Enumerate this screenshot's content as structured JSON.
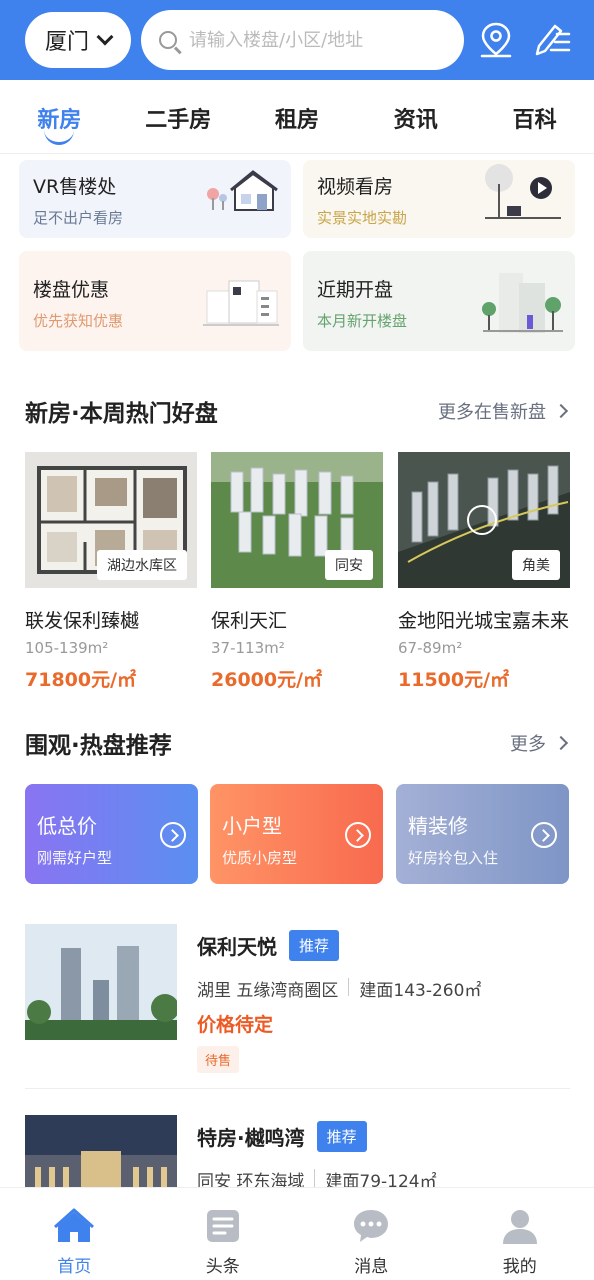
{
  "header": {
    "city": "厦门",
    "search_placeholder": "请输入楼盘/小区/地址"
  },
  "tabs": [
    {
      "label": "新房",
      "active": true
    },
    {
      "label": "二手房"
    },
    {
      "label": "租房"
    },
    {
      "label": "资讯"
    },
    {
      "label": "百科"
    }
  ],
  "features": [
    {
      "title": "VR售楼处",
      "subtitle": "足不出户看房"
    },
    {
      "title": "视频看房",
      "subtitle": "实景实地实勘"
    },
    {
      "title": "楼盘优惠",
      "subtitle": "优先获知优惠"
    },
    {
      "title": "近期开盘",
      "subtitle": "本月新开楼盘"
    }
  ],
  "hot_section": {
    "title": "新房·本周热门好盘",
    "more": "更多在售新盘",
    "items": [
      {
        "name": "联发保利臻樾",
        "area_tag": "湖边水库区",
        "size": "105-139m²",
        "price": "71800元/㎡"
      },
      {
        "name": "保利天汇",
        "area_tag": "同安",
        "size": "37-113m²",
        "price": "26000元/㎡"
      },
      {
        "name": "金地阳光城宝嘉未来",
        "area_tag": "角美",
        "size": "67-89m²",
        "price": "11500元/㎡"
      }
    ]
  },
  "recommend_section": {
    "title": "围观·热盘推荐",
    "more": "更多",
    "cards": [
      {
        "title": "低总价",
        "subtitle": "刚需好户型"
      },
      {
        "title": "小户型",
        "subtitle": "优质小房型"
      },
      {
        "title": "精装修",
        "subtitle": "好房拎包入住"
      }
    ]
  },
  "listings": [
    {
      "name": "保利天悦",
      "badge": "推荐",
      "location": "湖里 五缘湾商圈区",
      "area": "建面143-260㎡",
      "price": "价格待定",
      "status": "待售"
    },
    {
      "name": "特房·樾鸣湾",
      "badge": "推荐",
      "location": "同安 环东海域",
      "area": "建面79-124㎡"
    }
  ],
  "bottom_nav": [
    {
      "label": "首页",
      "icon": "home-icon",
      "active": true
    },
    {
      "label": "头条",
      "icon": "news-icon"
    },
    {
      "label": "消息",
      "icon": "message-icon"
    },
    {
      "label": "我的",
      "icon": "user-icon"
    }
  ],
  "colors": {
    "primary": "#3f82ee",
    "price": "#e96a2b"
  }
}
